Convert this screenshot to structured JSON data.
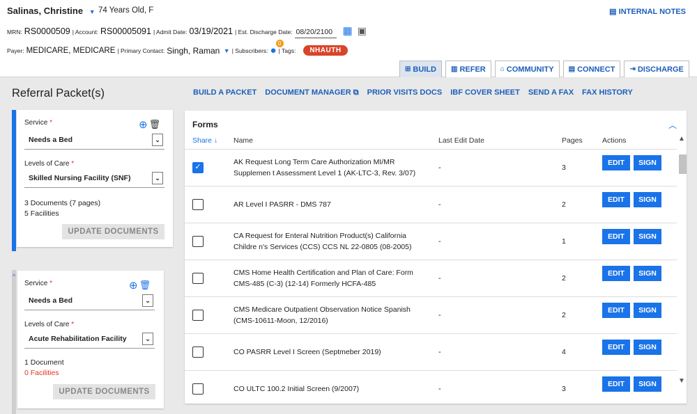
{
  "patient": {
    "name": "Salinas, Christine",
    "demo": "74 Years Old, F",
    "mrn_label": "MRN:",
    "mrn": "RS0000509",
    "account_label": "| Account:",
    "account": "RS00005091",
    "admit_label": "| Admit Date:",
    "admit": "03/19/2021",
    "discharge_label": "| Est. Discharge Date:",
    "discharge": "08/20/2100",
    "payer_label": "Payer:",
    "payer": "MEDICARE, MEDICARE",
    "contact_label": "| Primary Contact:",
    "contact": "Singh, Raman",
    "subs_label": "| Subscribers:",
    "subs_count": "0",
    "tags_label": "| Tags:",
    "tag": "NHAUTH"
  },
  "internal_notes": "INTERNAL NOTES",
  "tabs": [
    {
      "label": "BUILD"
    },
    {
      "label": "REFER"
    },
    {
      "label": "COMMUNITY"
    },
    {
      "label": "CONNECT"
    },
    {
      "label": "DISCHARGE"
    }
  ],
  "page_title": "Referral Packet(s)",
  "links": [
    {
      "label": "BUILD A PACKET"
    },
    {
      "label": "DOCUMENT MANAGER"
    },
    {
      "label": "PRIOR VISITS DOCS"
    },
    {
      "label": "IBF COVER SHEET"
    },
    {
      "label": "SEND A FAX"
    },
    {
      "label": "FAX HISTORY"
    }
  ],
  "packets": [
    {
      "service_label": "Service",
      "service": "Needs a Bed",
      "loc_label": "Levels of Care",
      "loc": "Skilled Nursing Facility (SNF)",
      "docs": "3 Documents (7 pages)",
      "facilities": "5 Facilities",
      "button": "UPDATE DOCUMENTS"
    },
    {
      "service_label": "Service",
      "service": "Needs a Bed",
      "loc_label": "Levels of Care",
      "loc": "Acute Rehabilitation Facility",
      "docs": "1 Document",
      "facilities": "0 Facilities",
      "button": "UPDATE DOCUMENTS"
    }
  ],
  "forms": {
    "title": "Forms",
    "headers": {
      "share": "Share",
      "name": "Name",
      "date": "Last Edit Date",
      "pages": "Pages",
      "actions": "Actions"
    },
    "edit_label": "EDIT",
    "sign_label": "SIGN",
    "rows": [
      {
        "name": "AK Request Long Term Care Authorization MI/MR Supplemen t Assessment Level 1 (AK-LTC-3, Rev. 3/07)",
        "date": "-",
        "pages": "3",
        "checked": true
      },
      {
        "name": "AR Level I PASRR - DMS 787",
        "date": "-",
        "pages": "2",
        "checked": false
      },
      {
        "name": "CA Request for Enteral Nutrition Product(s) California Childre n's Services (CCS) CCS NL 22-0805 (08-2005)",
        "date": "-",
        "pages": "1",
        "checked": false
      },
      {
        "name": "CMS Home Health Certification and Plan of Care: Form CMS-485 (C-3) (12-14) Formerly HCFA-485",
        "date": "-",
        "pages": "2",
        "checked": false
      },
      {
        "name": "CMS Medicare Outpatient Observation Notice Spanish (CMS-10611-Moon, 12/2016)",
        "date": "-",
        "pages": "2",
        "checked": false
      },
      {
        "name": "CO PASRR Level I Screen (Septmeber 2019)",
        "date": "-",
        "pages": "4",
        "checked": false
      },
      {
        "name": "CO ULTC 100.2 Initial Screen (9/2007)",
        "date": "-",
        "pages": "3",
        "checked": false
      }
    ]
  }
}
